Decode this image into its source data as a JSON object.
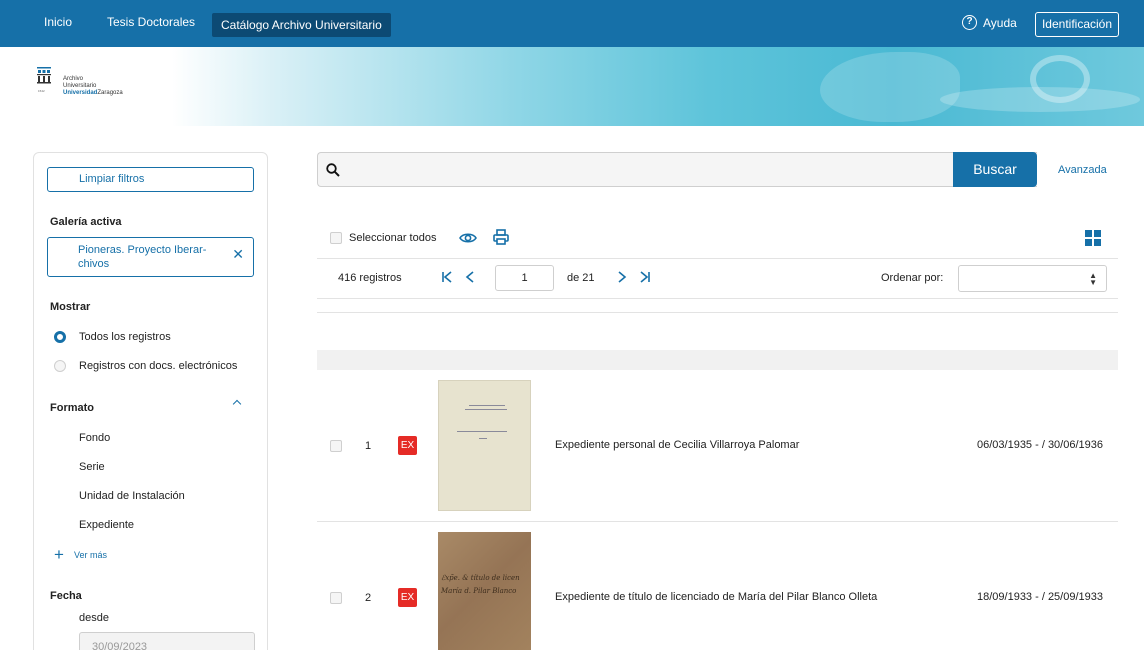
{
  "nav": {
    "links": [
      "Inicio",
      "Tesis Doctorales",
      "Catálogo Archivo Universitario"
    ],
    "help_label": "Ayuda",
    "login_label": "Identificación"
  },
  "logo": {
    "line1": "Archivo",
    "line2": "Universitario",
    "line3a": "Universidad",
    "line3b": "Zaragoza",
    "emblem_year": "1542"
  },
  "sidebar": {
    "clear_filters": "Limpiar filtros",
    "active_gallery_heading": "Galería activa",
    "active_gallery": "Pioneras. Proyecto Iberar-chivos",
    "show_heading": "Mostrar",
    "show_options": [
      {
        "label": "Todos los registros",
        "selected": true
      },
      {
        "label": "Registros con docs. electrónicos",
        "selected": false
      }
    ],
    "format_heading": "Formato",
    "format_items": [
      "Fondo",
      "Serie",
      "Unidad de Instalación",
      "Expediente"
    ],
    "see_more": "Ver más",
    "date_heading": "Fecha",
    "date_from_label": "desde",
    "date_from_placeholder": "30/09/2023"
  },
  "search": {
    "value": "",
    "button": "Buscar",
    "advanced": "Avanzada"
  },
  "toolbar": {
    "select_all": "Seleccionar todos"
  },
  "pager": {
    "count": "416 registros",
    "page": "1",
    "total": "de 21",
    "order_label": "Ordenar por:",
    "order_value": ""
  },
  "results": [
    {
      "num": "1",
      "badge": "EX",
      "title": "Expediente personal de Cecilia Villarroya Palomar",
      "dates": "06/03/1935 - / 30/06/1936"
    },
    {
      "num": "2",
      "badge": "EX",
      "title": "Expediente de título de licenciado de María del Pilar Blanco Olleta",
      "dates": "18/09/1933 - / 25/09/1933"
    }
  ],
  "colors": {
    "primary": "#1670a8",
    "nav_active": "#0c4a74",
    "badge": "#e52b26"
  }
}
